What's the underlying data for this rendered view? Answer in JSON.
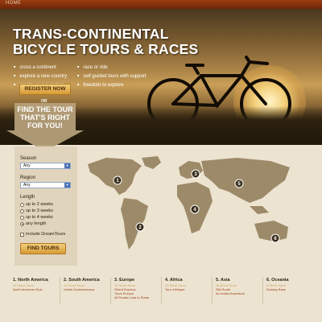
{
  "nav": {
    "home": "HOME"
  },
  "hero": {
    "title_line1": "TRANS-CONTINENTAL",
    "title_line2": "BICYCLE TOURS & RACES",
    "bullets_left": [
      "cross a continent",
      "explore a new country",
      "create your own tour"
    ],
    "bullets_right": [
      "race or ride",
      "self guided tours with support",
      "freedom to explore"
    ],
    "register_label": "REGISTER NOW",
    "or_label": "OR",
    "find_title": "FIND THE TOUR THAT'S RIGHT FOR YOU!"
  },
  "filter": {
    "season_label": "Season",
    "season_value": "Any",
    "region_label": "Region",
    "region_value": "Any",
    "length_label": "Length",
    "length_options": [
      "up to 2 weeks",
      "up to 3 weeks",
      "up to 4 weeks",
      "any length"
    ],
    "length_selected": "any length",
    "dreamtours_label": "Include DreamTours",
    "find_button": "FIND TOURS"
  },
  "map": {
    "markers": [
      "1",
      "2",
      "3",
      "4",
      "5",
      "6"
    ]
  },
  "regions": [
    {
      "name": "1. North America",
      "count": "11 Short Tours",
      "tours": [
        "North American Epic"
      ]
    },
    {
      "name": "2. South America",
      "count": "12 Short Tours",
      "tours": [
        "Vuelta Sudamericana"
      ]
    },
    {
      "name": "3. Europe",
      "count": "15 Short Tours",
      "tours": [
        "Orient Express",
        "Tours Europa",
        "All Roads Lead to Rome"
      ]
    },
    {
      "name": "4. Africa",
      "count": "23 Short Tours",
      "tours": [
        "Tour d'Afrique"
      ]
    },
    {
      "name": "5. Asia",
      "count": "18 Short Tours",
      "tours": [
        "Silk Route",
        "An Indian Adventure"
      ]
    },
    {
      "name": "6. Oceania",
      "count": "6 Short Tours",
      "tours": [
        "Sunday Race"
      ]
    }
  ],
  "colors": {
    "accent": "#9a3e12",
    "button": "#e0ac4a",
    "map_land": "#9c8a69",
    "background": "#ede3d1"
  }
}
